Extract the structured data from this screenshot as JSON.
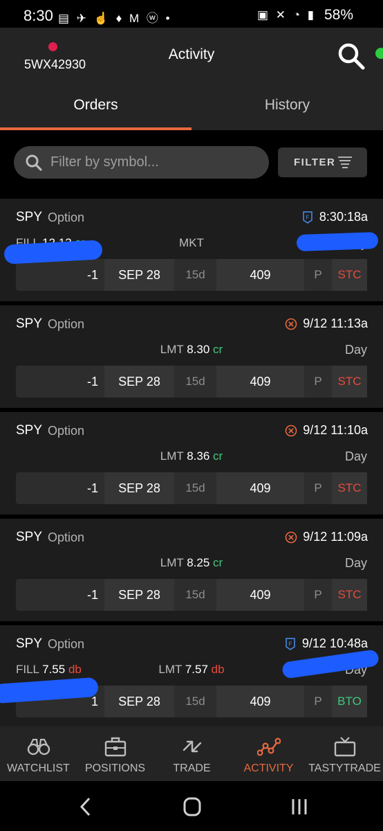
{
  "status_bar": {
    "time": "8:30",
    "left_icons": "▤ ✈ ☝ ♦ M ⓦ •",
    "right_icons": "▣ ✕ ◔ ▮",
    "battery": "58%"
  },
  "header": {
    "account_id": "5WX42930",
    "title": "Activity",
    "tabs": [
      {
        "label": "Orders",
        "active": true
      },
      {
        "label": "History",
        "active": false
      }
    ]
  },
  "filter": {
    "search_placeholder": "Filter by symbol...",
    "filter_label": "FILTER"
  },
  "orders": [
    {
      "symbol": "SPY",
      "type": "Option",
      "status_icon": "filled-icon",
      "time": "8:30:18a",
      "fill_label": "FILL",
      "fill_value": "12.13",
      "fill_suffix": "cr",
      "price_type": "MKT",
      "price_value": "",
      "price_suffix": "",
      "tif": "Day",
      "leg": {
        "qty": "-1",
        "exp": "SEP 28",
        "dte": "15d",
        "strike": "409",
        "pc": "P",
        "action": "STC"
      }
    },
    {
      "symbol": "SPY",
      "type": "Option",
      "status_icon": "cancelled-icon",
      "time": "9/12 11:13a",
      "fill_label": "",
      "fill_value": "",
      "fill_suffix": "",
      "price_type": "LMT",
      "price_value": "8.30",
      "price_suffix": "cr",
      "tif": "Day",
      "leg": {
        "qty": "-1",
        "exp": "SEP 28",
        "dte": "15d",
        "strike": "409",
        "pc": "P",
        "action": "STC"
      }
    },
    {
      "symbol": "SPY",
      "type": "Option",
      "status_icon": "cancelled-icon",
      "time": "9/12 11:10a",
      "fill_label": "",
      "fill_value": "",
      "fill_suffix": "",
      "price_type": "LMT",
      "price_value": "8.36",
      "price_suffix": "cr",
      "tif": "Day",
      "leg": {
        "qty": "-1",
        "exp": "SEP 28",
        "dte": "15d",
        "strike": "409",
        "pc": "P",
        "action": "STC"
      }
    },
    {
      "symbol": "SPY",
      "type": "Option",
      "status_icon": "cancelled-icon",
      "time": "9/12 11:09a",
      "fill_label": "",
      "fill_value": "",
      "fill_suffix": "",
      "price_type": "LMT",
      "price_value": "8.25",
      "price_suffix": "cr",
      "tif": "Day",
      "leg": {
        "qty": "-1",
        "exp": "SEP 28",
        "dte": "15d",
        "strike": "409",
        "pc": "P",
        "action": "STC"
      }
    },
    {
      "symbol": "SPY",
      "type": "Option",
      "status_icon": "filled-icon",
      "time": "9/12 10:48a",
      "fill_label": "FILL",
      "fill_value": "7.55",
      "fill_suffix": "db",
      "price_type": "LMT",
      "price_value": "7.57",
      "price_suffix": "db",
      "tif": "Day",
      "leg": {
        "qty": "1",
        "exp": "SEP 28",
        "dte": "15d",
        "strike": "409",
        "pc": "P",
        "action": "BTO"
      }
    }
  ],
  "bottom_nav": [
    {
      "label": "WATCHLIST",
      "icon": "binoculars-icon",
      "active": false
    },
    {
      "label": "POSITIONS",
      "icon": "briefcase-icon",
      "active": false
    },
    {
      "label": "TRADE",
      "icon": "trade-arrows-icon",
      "active": false
    },
    {
      "label": "ACTIVITY",
      "icon": "activity-icon",
      "active": true
    },
    {
      "label": "TASTYTRADE",
      "icon": "tv-icon",
      "active": false
    }
  ],
  "colors": {
    "accent": "#e8693f",
    "credit": "#3fc77a",
    "debit": "#e64b3c",
    "account_dot": "#e01f4f",
    "scribble": "#1d5cff"
  }
}
